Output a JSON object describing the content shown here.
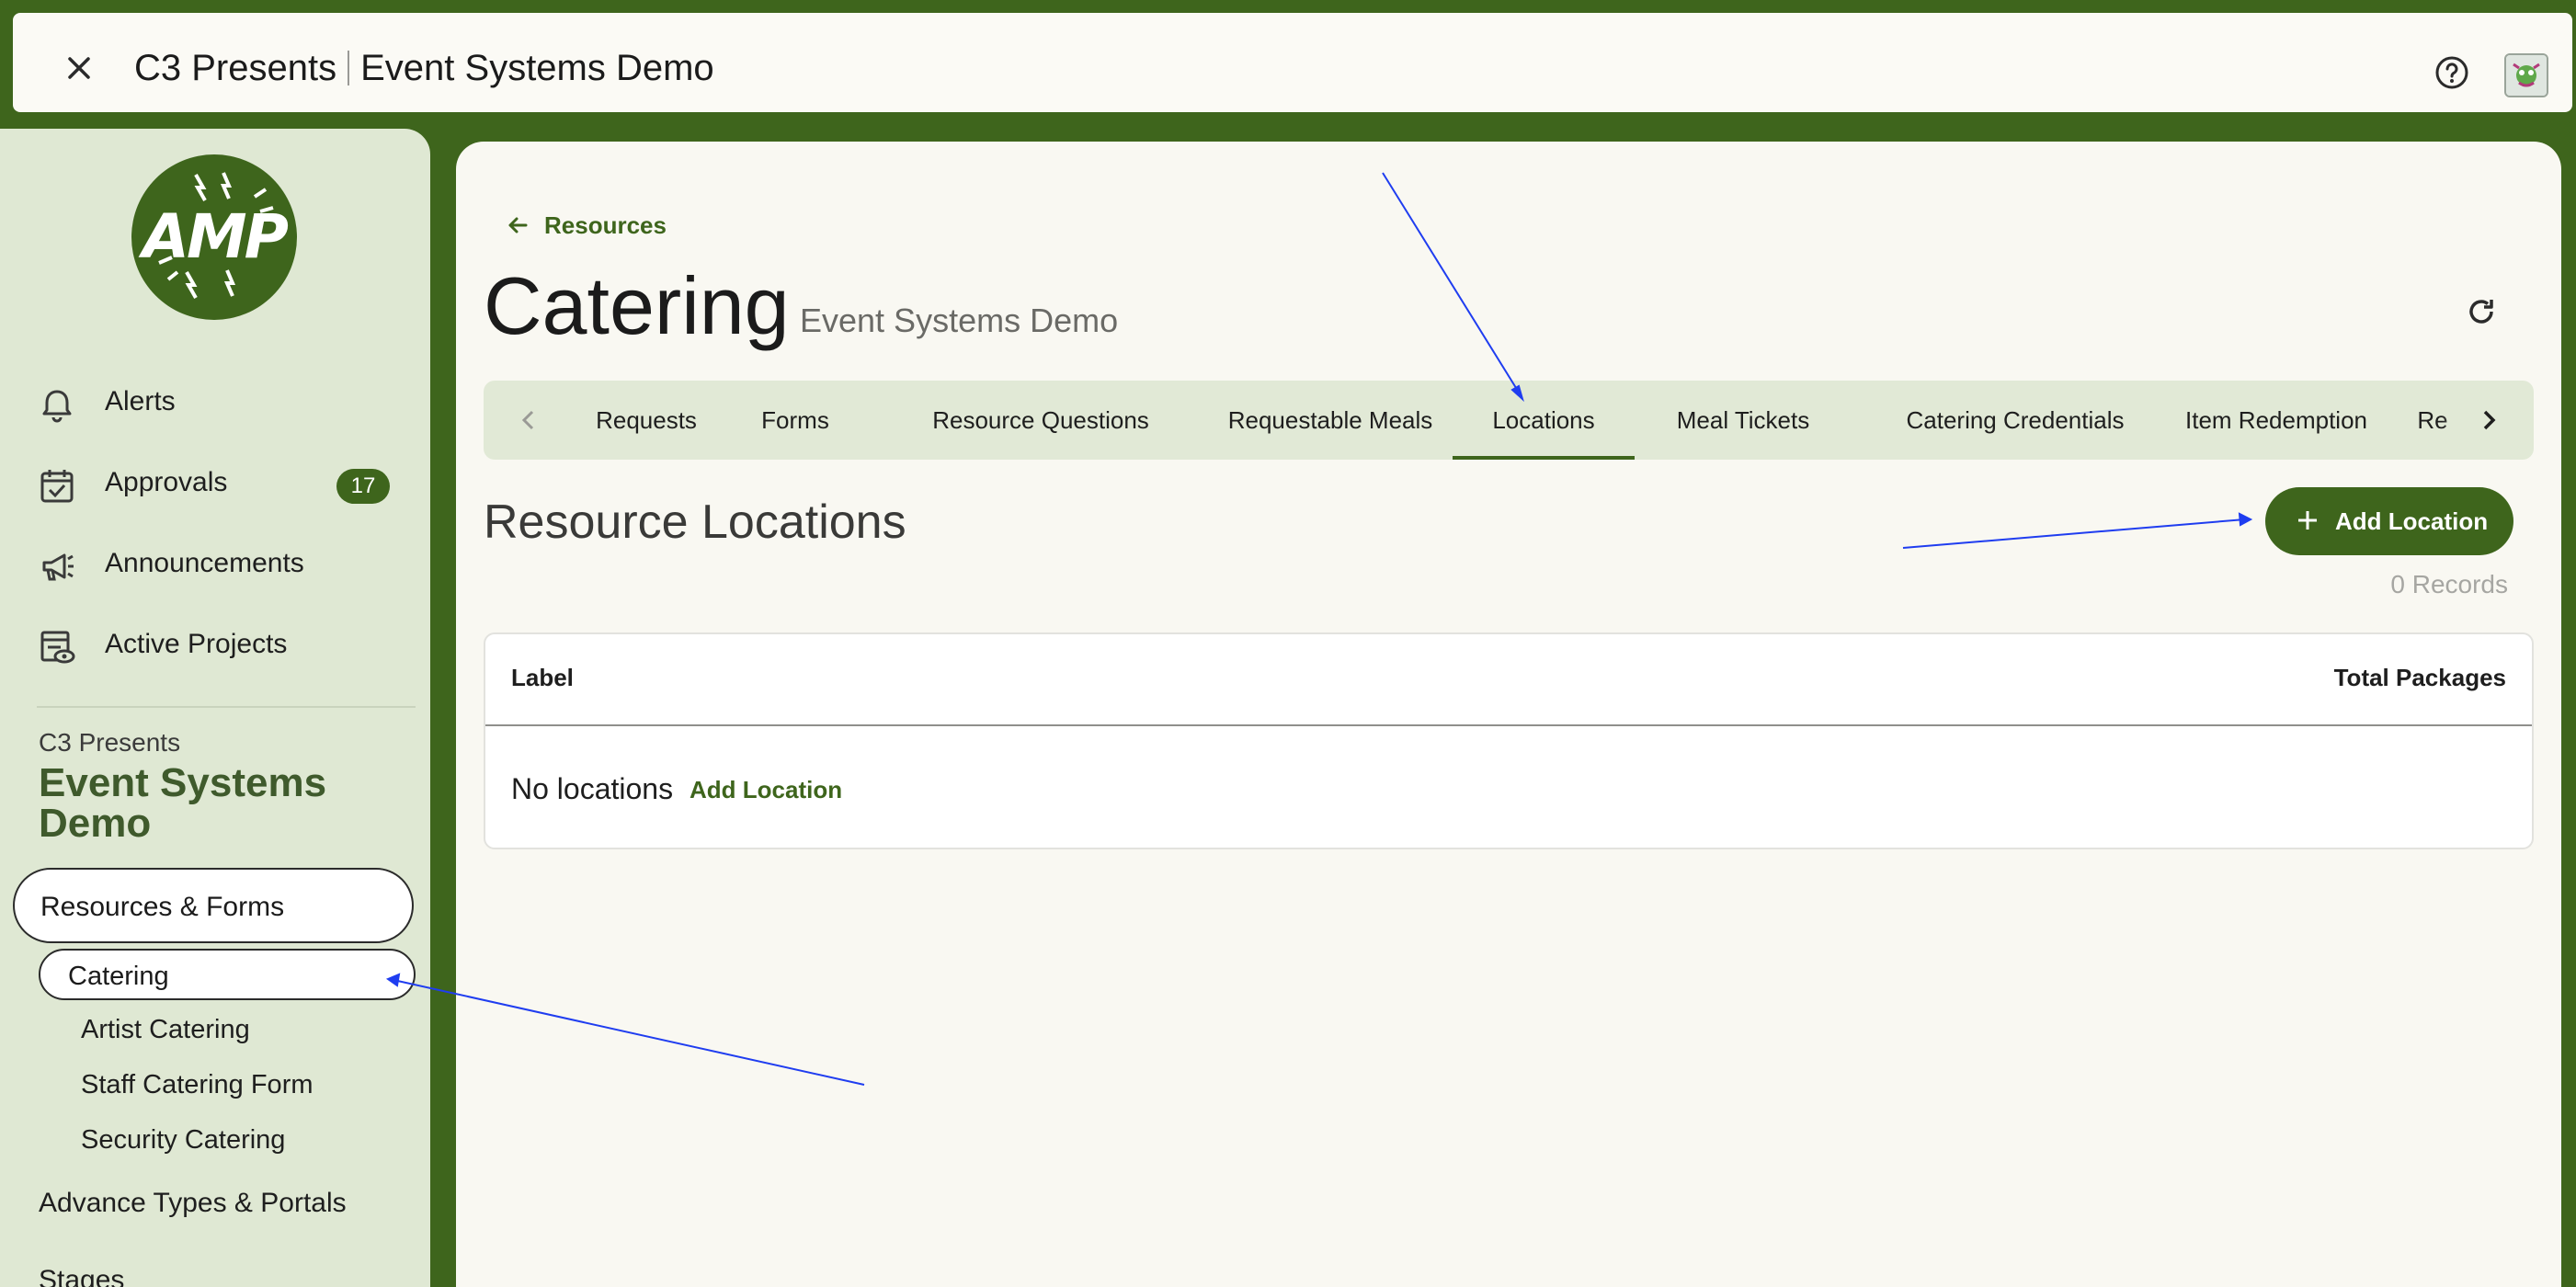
{
  "topbar": {
    "close_icon": "close-icon",
    "org": "C3 Presents",
    "project": "Event Systems Demo",
    "help_icon": "help-icon",
    "avatar_icon": "avatar-icon"
  },
  "sidebar": {
    "logo_text": "AMP",
    "nav": [
      {
        "label": "Alerts",
        "icon": "bell-icon"
      },
      {
        "label": "Approvals",
        "icon": "calendar-check-icon",
        "badge": "17"
      },
      {
        "label": "Announcements",
        "icon": "megaphone-icon"
      },
      {
        "label": "Active Projects",
        "icon": "project-view-icon"
      }
    ],
    "org": "C3 Presents",
    "project": "Event Systems Demo",
    "section": "Resources & Forms",
    "active_item": "Catering",
    "sub_items": [
      "Artist Catering",
      "Staff Catering Form",
      "Security Catering"
    ],
    "next_section": "Advance Types & Portals",
    "cut_item": "Stages"
  },
  "main": {
    "back_label": "Resources",
    "title": "Catering",
    "subtitle": "Event Systems Demo",
    "tabs": [
      "Requests",
      "Forms",
      "Resource Questions",
      "Requestable Meals",
      "Locations",
      "Meal Tickets",
      "Catering Credentials",
      "Item Redemption",
      "Re"
    ],
    "active_tab": "Locations",
    "section_title": "Resource Locations",
    "add_button": "Add Location",
    "records": "0 Records",
    "table": {
      "columns": [
        "Label",
        "Total Packages"
      ],
      "empty_text": "No locations",
      "empty_link": "Add Location"
    }
  },
  "colors": {
    "brand": "#3e651c",
    "sidebar_bg": "#dfe8d3",
    "page_bg": "#f9f8f2",
    "annotation": "#1f3df0"
  }
}
